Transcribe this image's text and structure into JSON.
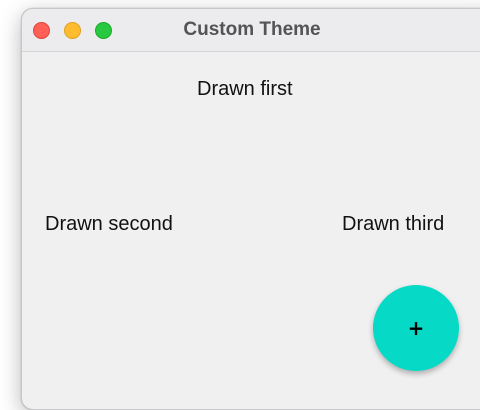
{
  "window": {
    "title": "Custom Theme",
    "controls": [
      "close",
      "minimize",
      "maximize"
    ]
  },
  "content": {
    "first_label": "Drawn first",
    "second_label": "Drawn second",
    "third_label": "Drawn third"
  },
  "fab": {
    "label": "+",
    "color": "#06dac6"
  },
  "colors": {
    "close": "#fe5f57",
    "minimize": "#febc2e",
    "maximize": "#28c840",
    "window_background": "#f0f0f1"
  }
}
